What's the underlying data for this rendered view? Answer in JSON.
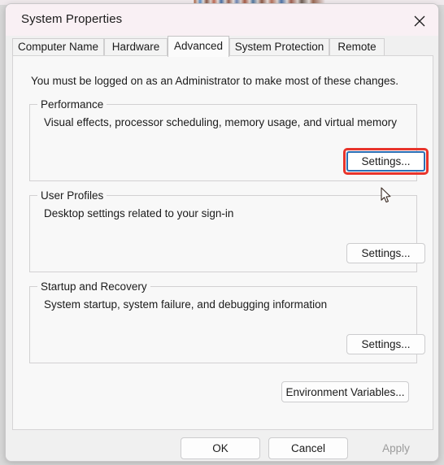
{
  "window": {
    "title": "System Properties",
    "close_icon": "close-icon"
  },
  "tabs": [
    {
      "label": "Computer Name",
      "selected": false
    },
    {
      "label": "Hardware",
      "selected": false
    },
    {
      "label": "Advanced",
      "selected": true
    },
    {
      "label": "System Protection",
      "selected": false
    },
    {
      "label": "Remote",
      "selected": false
    }
  ],
  "panel": {
    "intro": "You must be logged on as an Administrator to make most of these changes.",
    "groups": [
      {
        "legend": "Performance",
        "description": "Visual effects, processor scheduling, memory usage, and virtual memory",
        "button": "Settings...",
        "highlighted": true
      },
      {
        "legend": "User Profiles",
        "description": "Desktop settings related to your sign-in",
        "button": "Settings...",
        "highlighted": false
      },
      {
        "legend": "Startup and Recovery",
        "description": "System startup, system failure, and debugging information",
        "button": "Settings...",
        "highlighted": false
      }
    ],
    "environment_variables_button": "Environment Variables..."
  },
  "footer": {
    "ok": "OK",
    "cancel": "Cancel",
    "apply": "Apply"
  },
  "colors": {
    "highlight_ring": "#e8342b",
    "focus_border": "#2b6fb5",
    "titlebar": "#f9f0f4",
    "panel": "#f8f8f8",
    "dialog": "#f0f0f0"
  }
}
